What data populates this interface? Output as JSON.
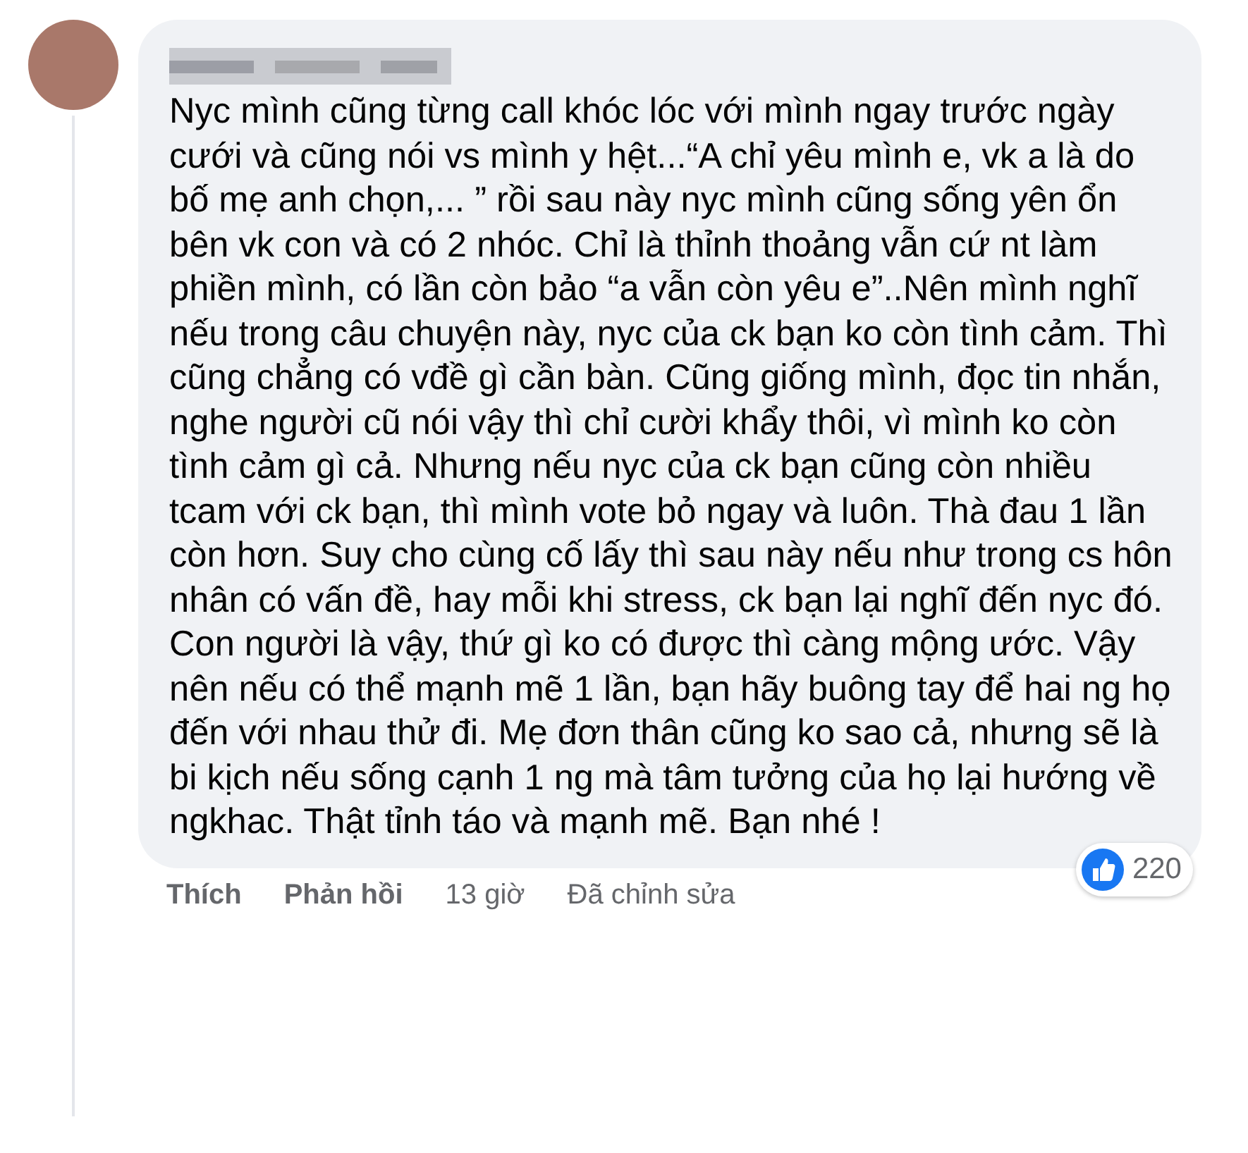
{
  "comment": {
    "text": "Nyc mình cũng từng call khóc lóc với mình ngay trước ngày cưới và cũng nói vs mình y hệt...“A chỉ yêu mình e, vk a là do bố mẹ anh chọn,... ” rồi sau này nyc mình cũng sống yên ổn bên vk con và có 2 nhóc. Chỉ là thỉnh thoảng vẫn cứ nt làm phiền mình, có lần còn bảo “a vẫn còn yêu e”..Nên mình nghĩ nếu trong câu chuyện này, nyc của ck bạn ko còn tình cảm. Thì cũng chẳng có vđề gì cần bàn. Cũng giống mình, đọc tin nhắn, nghe người cũ nói vậy thì chỉ cười khẩy thôi, vì mình ko còn tình cảm gì cả. Nhưng nếu nyc của ck bạn cũng còn nhiều tcam với ck bạn, thì mình vote bỏ ngay và luôn. Thà đau 1 lần còn hơn. Suy cho cùng cố lấy thì sau này nếu như trong cs hôn nhân có vấn đề, hay mỗi khi stress, ck bạn lại nghĩ đến nyc đó. Con người là vậy, thứ gì ko có được thì càng mộng ước. Vậy nên nếu có thể mạnh mẽ 1 lần, bạn hãy buông tay để hai ng họ đến với nhau thử đi. Mẹ đơn thân cũng ko sao cả, nhưng sẽ là bi kịch nếu sống cạnh 1 ng mà tâm tưởng của họ lại hướng về ngkhac. Thật tỉnh táo và mạnh mẽ. Bạn nhé !",
    "reactions": "220",
    "actions": [
      {
        "kind": "button",
        "label": "Thích"
      },
      {
        "kind": "button",
        "label": "Phản hồi"
      },
      {
        "kind": "meta",
        "label": "13 giờ"
      },
      {
        "kind": "meta",
        "label": "Đã chỉnh sửa"
      }
    ]
  }
}
